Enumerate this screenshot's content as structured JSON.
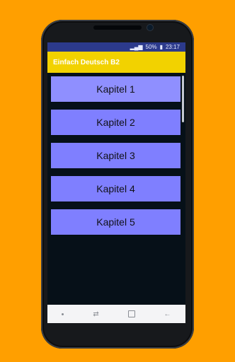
{
  "status": {
    "signal": "▂▄▆",
    "battery": "50%",
    "time": "23:17"
  },
  "appbar": {
    "title": "Einfach Deutsch B2"
  },
  "chapters": [
    {
      "label": "Kapitel 1"
    },
    {
      "label": "Kapitel 2"
    },
    {
      "label": "Kapitel 3"
    },
    {
      "label": "Kapitel 4"
    },
    {
      "label": "Kapitel 5"
    }
  ],
  "icons": {
    "back": "←",
    "home": "square",
    "recent": "switch"
  }
}
